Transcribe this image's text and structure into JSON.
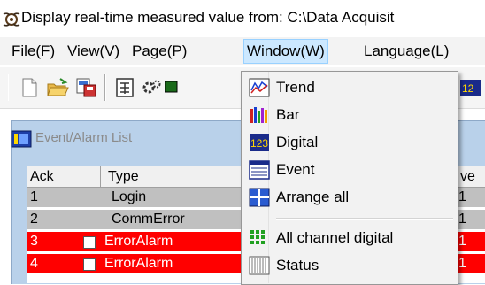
{
  "window": {
    "title": "Display real-time measured value from: C:\\Data Acquisit"
  },
  "menubar": {
    "items": [
      {
        "label": "File(F)"
      },
      {
        "label": "View(V)"
      },
      {
        "label": "Page(P)"
      },
      {
        "label": "Window(W)",
        "active": true
      },
      {
        "label": "Language(L)"
      }
    ]
  },
  "toolbar": {
    "buttons": [
      "new-file-icon",
      "open-folder-icon",
      "save-icon",
      "calculator-icon",
      "gear-icon",
      "display-icon",
      "digital-icon"
    ]
  },
  "child_window": {
    "title": "Event/Alarm List",
    "columns": [
      {
        "label": "Ack"
      },
      {
        "label": "Type"
      },
      {
        "label": "ve"
      }
    ],
    "rows": [
      {
        "ack": "1",
        "type": "Login",
        "tail": "1",
        "alarm": false
      },
      {
        "ack": "2",
        "type": "CommError",
        "tail": "1",
        "alarm": false
      },
      {
        "ack": "3",
        "type": "ErrorAlarm",
        "tail": "1",
        "alarm": true
      },
      {
        "ack": "4",
        "type": "ErrorAlarm",
        "tail": "1",
        "alarm": true
      }
    ]
  },
  "window_menu": {
    "items": [
      {
        "label": "Trend",
        "icon": "trend-chart-icon"
      },
      {
        "label": "Bar",
        "icon": "bar-chart-icon"
      },
      {
        "label": "Digital",
        "icon": "digital-display-icon"
      },
      {
        "label": "Event",
        "icon": "event-list-icon"
      },
      {
        "label": "Arrange all",
        "icon": "arrange-windows-icon"
      },
      {
        "label": "All channel digital",
        "icon": "all-channel-digital-icon"
      },
      {
        "label": "Status",
        "icon": "status-icon"
      }
    ]
  },
  "colors": {
    "alarm_row": "#ff0000",
    "normal_row": "#c0c0c0",
    "menu_highlight": "#cce8ff",
    "child_frame": "#b9d1ea"
  }
}
